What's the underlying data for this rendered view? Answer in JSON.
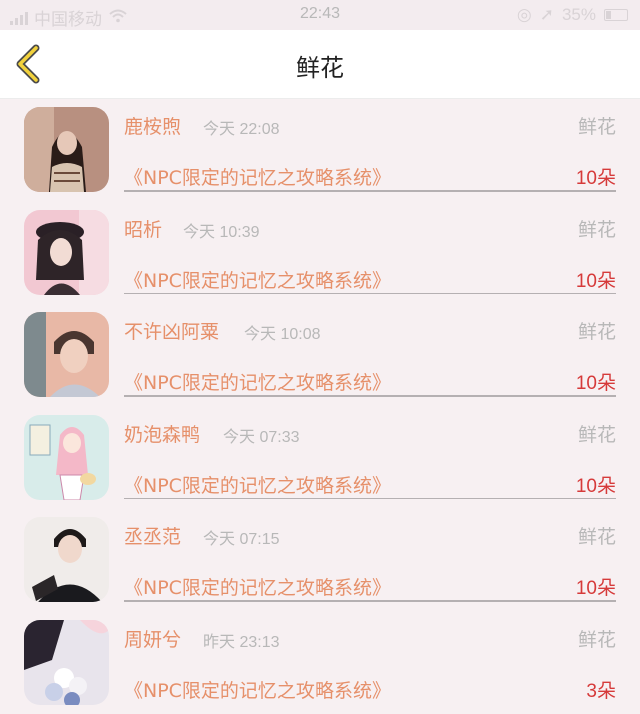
{
  "status_bar": {
    "carrier": "中国移动",
    "time": "22:43",
    "battery": "35%"
  },
  "nav": {
    "title": "鲜花"
  },
  "gifts": [
    {
      "name": "鹿桉煦",
      "time": "今天 22:08",
      "type": "鲜花",
      "book": "《NPC限定的记忆之攻略系统》",
      "count": "10朵",
      "avatar": "woman-dark-hair"
    },
    {
      "name": "昭析",
      "time": "今天 10:39",
      "type": "鲜花",
      "book": "《NPC限定的记忆之攻略系统》",
      "count": "10朵",
      "avatar": "girl-beret"
    },
    {
      "name": "不许凶阿粟",
      "time": "今天 10:08",
      "type": "鲜花",
      "book": "《NPC限定的记忆之攻略系统》",
      "count": "10朵",
      "avatar": "boy-portrait"
    },
    {
      "name": "奶泡森鸭",
      "time": "今天 07:33",
      "type": "鲜花",
      "book": "《NPC限定的记忆之攻略系统》",
      "count": "10朵",
      "avatar": "cartoon-girl"
    },
    {
      "name": "丞丞范",
      "time": "今天 07:15",
      "type": "鲜花",
      "book": "《NPC限定的记忆之攻略系统》",
      "count": "10朵",
      "avatar": "man-black-shirt"
    },
    {
      "name": "周妍兮",
      "time": "昨天 23:13",
      "type": "鲜花",
      "book": "《NPC限定的记忆之攻略系统》",
      "count": "3朵",
      "avatar": "flowers-bouquet"
    }
  ],
  "colors": {
    "accent_orange": "#e6906a",
    "count_red": "#d63a3a",
    "back_yellow": "#f2d23c"
  }
}
